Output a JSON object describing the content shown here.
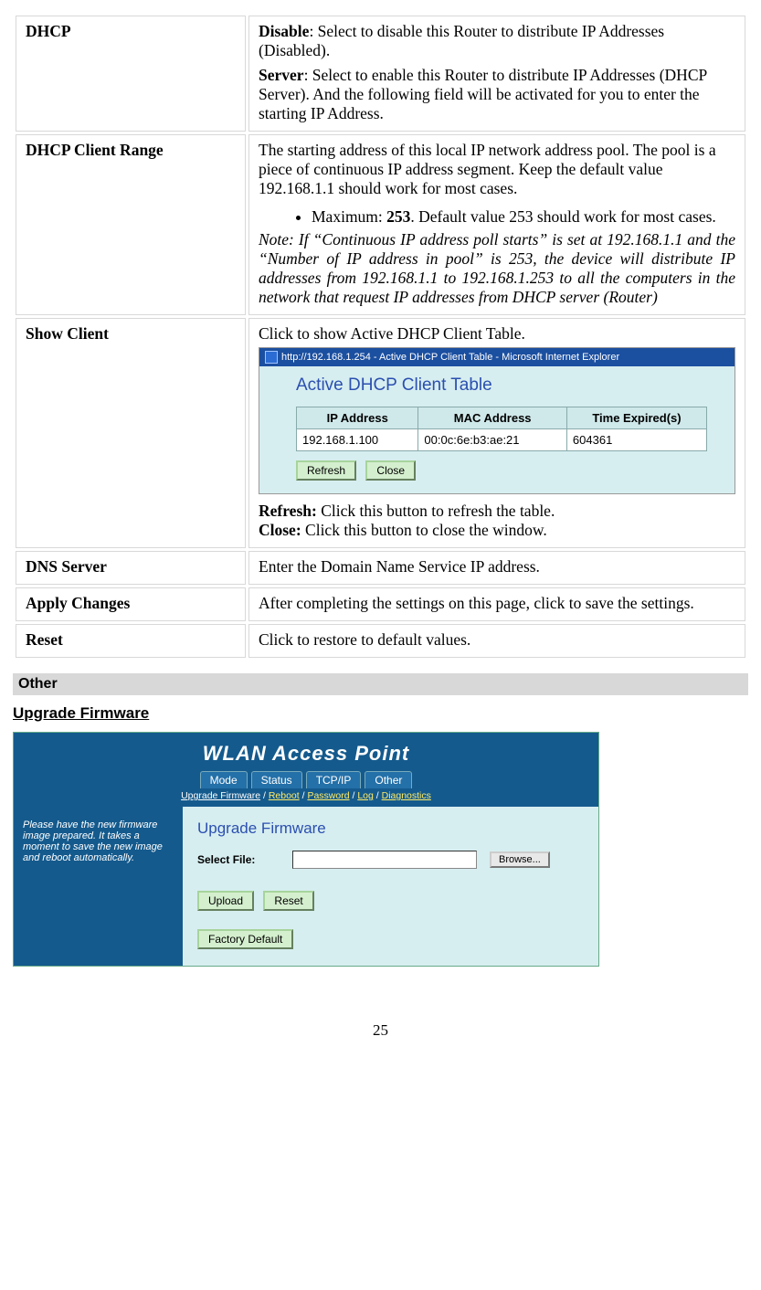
{
  "rows": {
    "dhcp": {
      "label": "DHCP",
      "disable_bold": "Disable",
      "disable_text": ": Select to disable this Router to distribute IP Addresses (Disabled).",
      "server_bold": "Server",
      "server_text": ": Select to enable this Router to distribute IP Addresses (DHCP Server). And the following field will be activated for you to enter the starting IP Address."
    },
    "range": {
      "label": "DHCP Client Range",
      "intro": "The starting address of this local IP network address pool. The pool is a piece of continuous IP address segment. Keep the default value 192.168.1.1 should work for most cases.",
      "bullet_pre": "Maximum: ",
      "bullet_bold": "253",
      "bullet_post": ".  Default value 253 should work for most cases.",
      "note": "Note: If “Continuous IP address poll starts” is set at 192.168.1.1 and the “Number of IP address in pool” is 253, the device will distribute IP addresses from 192.168.1.1 to 192.168.1.253 to all the computers in the network that request IP addresses from DHCP server (Router)"
    },
    "show_client": {
      "label": "Show Client",
      "intro": "Click to show Active DHCP Client Table.",
      "refresh_bold": "Refresh: ",
      "refresh_text": "Click this button to refresh the table.",
      "close_bold": "Close: ",
      "close_text": "Click this button to close the window."
    },
    "dns": {
      "label": "DNS Server",
      "text": "Enter the Domain Name Service IP address."
    },
    "apply": {
      "label": "Apply Changes",
      "text": "After completing the settings on this page, click to save the settings."
    },
    "reset": {
      "label": "Reset",
      "text": "Click  to restore to default values."
    }
  },
  "popup": {
    "titlebar": "http://192.168.1.254 - Active DHCP Client Table - Microsoft Internet Explorer",
    "heading": "Active DHCP Client Table",
    "headers": {
      "ip": "IP Address",
      "mac": "MAC Address",
      "time": "Time Expired(s)"
    },
    "row": {
      "ip": "192.168.1.100",
      "mac": "00:0c:6e:b3:ae:21",
      "time": "604361"
    },
    "refresh_btn": "Refresh",
    "close_btn": "Close"
  },
  "other_bar": "Other",
  "firmware_heading": "Upgrade Firmware",
  "fw": {
    "title": "WLAN Access Point",
    "tabs": {
      "mode": "Mode",
      "status": "Status",
      "tcpip": "TCP/IP",
      "other": "Other"
    },
    "subnav": {
      "upgrade": "Upgrade Firmware",
      "reboot": "Reboot",
      "password": "Password",
      "log": "Log",
      "diagnostics": "Diagnostics",
      "sep": " / "
    },
    "left_help": "Please have the new firmware image prepared. It takes a moment to save the new image and reboot automatically.",
    "panel_heading": "Upgrade Firmware",
    "select_file_label": "Select File:",
    "browse_btn": "Browse...",
    "upload_btn": "Upload",
    "reset_btn": "Reset",
    "factory_btn": "Factory Default"
  },
  "page_number": "25",
  "chart_data": {
    "type": "table",
    "title": "Active DHCP Client Table",
    "columns": [
      "IP Address",
      "MAC Address",
      "Time Expired(s)"
    ],
    "rows": [
      [
        "192.168.1.100",
        "00:0c:6e:b3:ae:21",
        "604361"
      ]
    ]
  }
}
